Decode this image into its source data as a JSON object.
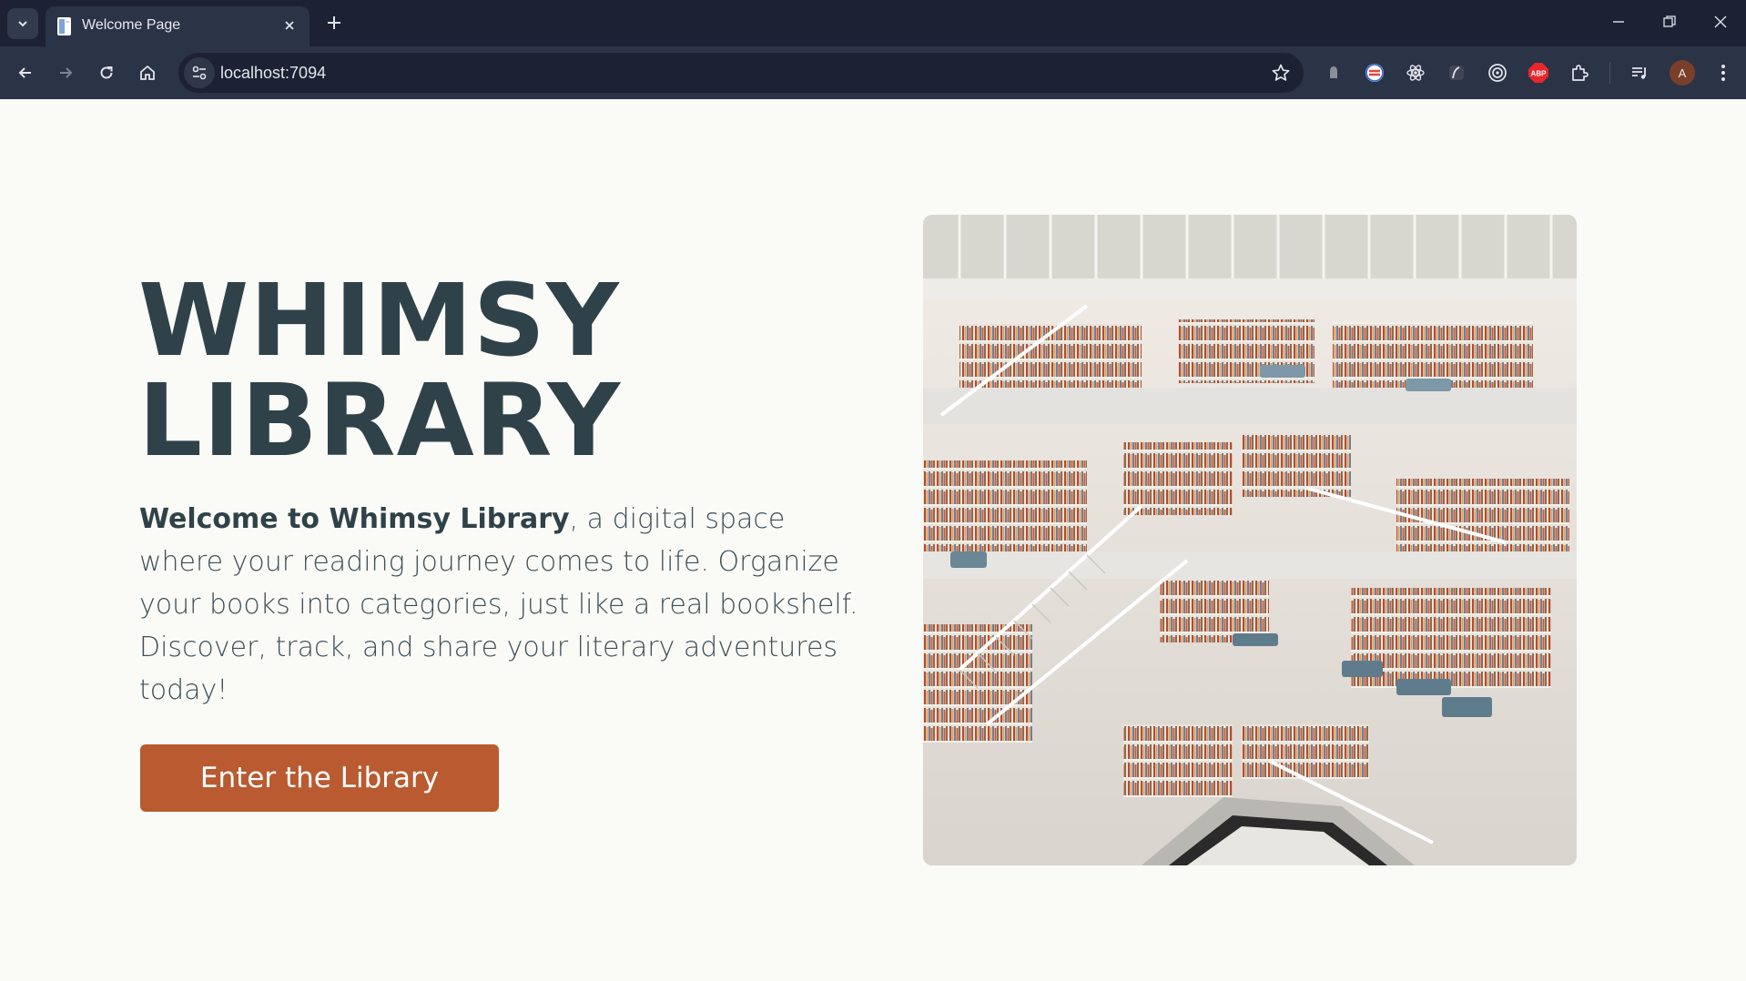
{
  "browser": {
    "tab_title": "Welcome Page",
    "url": "localhost:7094",
    "profile_initial": "A",
    "extensions": [
      "shield-extension-icon",
      "circle-logo-extension-icon",
      "react-extension-icon",
      "feather-extension-icon",
      "target-extension-icon",
      "adblock-extension-icon",
      "puzzle-extensions-icon"
    ],
    "adblock_label": "ABP"
  },
  "hero": {
    "title_line1": "WHIMSY",
    "title_line2": "LIBRARY",
    "intro_bold": "Welcome to Whimsy Library",
    "intro_rest": ", a digital space where your reading journey comes to life. Organize your books into categories, just like a real bookshelf. Discover, track, and share your literary adventures today!",
    "cta_label": "Enter the Library",
    "image": "library-atrium-photo"
  },
  "colors": {
    "title": "#2f4249",
    "accent": "#b95a30",
    "background": "#fafaf7",
    "chrome_dark": "#1c2233",
    "chrome": "#2b3347"
  }
}
